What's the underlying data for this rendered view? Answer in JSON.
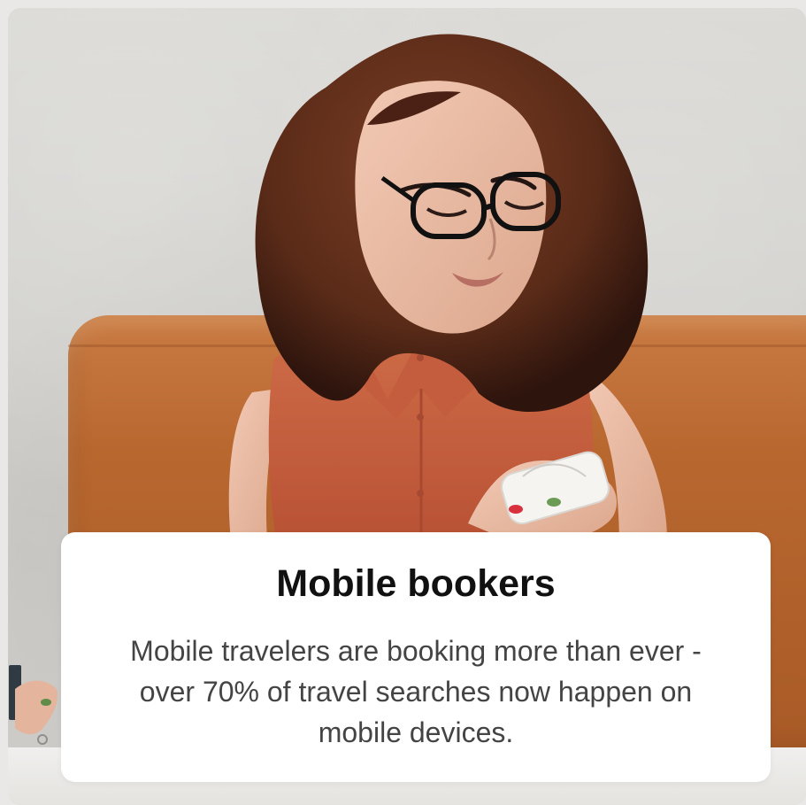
{
  "card": {
    "title": "Mobile bookers",
    "description": "Mobile travelers are booking more than ever - over 70% of travel searches now happen on mobile devices."
  },
  "photo": {
    "subject": "woman-with-glasses-using-smartphone"
  },
  "colors": {
    "background": "#e9e8e6",
    "wall": "#d3d2ce",
    "bench": "#b8672f",
    "shirt": "#c35f3c",
    "hair": "#5a2b18",
    "caption_background": "#ffffff",
    "title": "#111111",
    "body_text": "#444444"
  }
}
